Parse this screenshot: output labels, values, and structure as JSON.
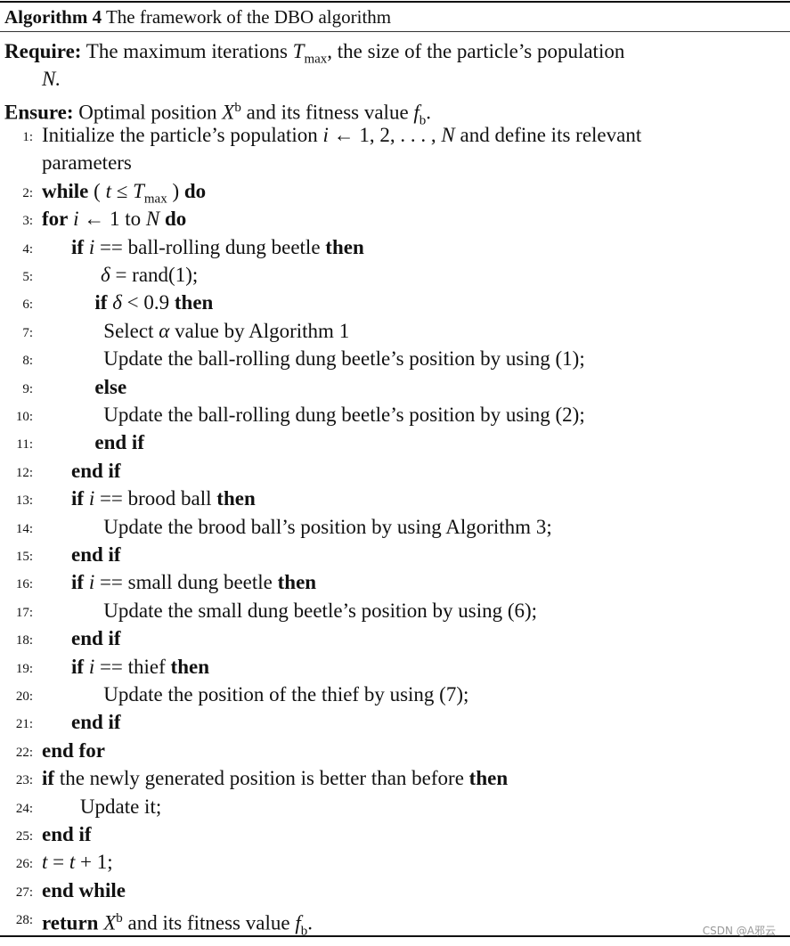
{
  "caption": {
    "label": "Algorithm 4",
    "title": "The framework of the DBO algorithm"
  },
  "require": {
    "label": "Require:",
    "text_a": "The maximum iterations ",
    "var": "T",
    "sub": "max",
    "text_b": ", the size of the particle’s population",
    "cont": "N."
  },
  "ensure": {
    "label": "Ensure:",
    "text_a": "Optimal position ",
    "var": "X",
    "sup": "b",
    "text_b": " and its fitness value ",
    "var2": "f",
    "sub2": "b",
    "end": "."
  },
  "lines": [
    {
      "n": "1:",
      "parts": [
        [
          "t",
          "Initialize the particle’s population "
        ],
        [
          "i",
          "i"
        ],
        [
          "t",
          " ← 1, 2, . . . , "
        ],
        [
          "i",
          "N"
        ],
        [
          "t",
          " and define its relevant"
        ]
      ],
      "indent": 0
    },
    {
      "n": "",
      "parts": [
        [
          "t",
          "parameters"
        ]
      ],
      "indent": 0
    },
    {
      "n": "2:",
      "parts": [
        [
          "k",
          "while"
        ],
        [
          "t",
          " ( "
        ],
        [
          "i",
          "t"
        ],
        [
          "t",
          " ≤ "
        ],
        [
          "i",
          "T"
        ],
        [
          "sub",
          "max"
        ],
        [
          "t",
          " ) "
        ],
        [
          "k",
          "do"
        ]
      ],
      "indent": 0
    },
    {
      "n": "3:",
      "parts": [
        [
          "k",
          "for"
        ],
        [
          "t",
          " "
        ],
        [
          "i",
          "i"
        ],
        [
          "t",
          " ← 1 to "
        ],
        [
          "i",
          "N"
        ],
        [
          "t",
          " "
        ],
        [
          "k",
          "do"
        ]
      ],
      "indent": 0
    },
    {
      "n": "4:",
      "parts": [
        [
          "k",
          "if"
        ],
        [
          "t",
          " "
        ],
        [
          "i",
          "i"
        ],
        [
          "t",
          " == ball-rolling dung beetle "
        ],
        [
          "k",
          "then"
        ]
      ],
      "indent": 1
    },
    {
      "n": "5:",
      "parts": [
        [
          "i",
          "δ"
        ],
        [
          "t",
          " = rand(1);"
        ]
      ],
      "indent": 2
    },
    {
      "n": "6:",
      "parts": [
        [
          "k",
          "if"
        ],
        [
          "t",
          " "
        ],
        [
          "i",
          "δ"
        ],
        [
          "t",
          " < 0.9 "
        ],
        [
          "k",
          "then"
        ]
      ],
      "indent": 1.8
    },
    {
      "n": "7:",
      "parts": [
        [
          "t",
          "Select "
        ],
        [
          "i",
          "α"
        ],
        [
          "t",
          " value by Algorithm 1"
        ]
      ],
      "indent": 2.1
    },
    {
      "n": "8:",
      "parts": [
        [
          "t",
          "Update the ball-rolling dung beetle’s position by using (1);"
        ]
      ],
      "indent": 2.1
    },
    {
      "n": "9:",
      "parts": [
        [
          "k",
          "else"
        ]
      ],
      "indent": 1.8
    },
    {
      "n": "10:",
      "parts": [
        [
          "t",
          "Update the ball-rolling dung beetle’s position by using (2);"
        ]
      ],
      "indent": 2.1
    },
    {
      "n": "11:",
      "parts": [
        [
          "k",
          "end if"
        ]
      ],
      "indent": 1.8
    },
    {
      "n": "12:",
      "parts": [
        [
          "k",
          "end if"
        ]
      ],
      "indent": 1
    },
    {
      "n": "13:",
      "parts": [
        [
          "k",
          "if"
        ],
        [
          "t",
          " "
        ],
        [
          "i",
          "i"
        ],
        [
          "t",
          " == brood ball "
        ],
        [
          "k",
          "then"
        ]
      ],
      "indent": 1
    },
    {
      "n": "14:",
      "parts": [
        [
          "t",
          "Update the brood ball’s position by using Algorithm 3;"
        ]
      ],
      "indent": 2.1
    },
    {
      "n": "15:",
      "parts": [
        [
          "k",
          "end if"
        ]
      ],
      "indent": 1
    },
    {
      "n": "16:",
      "parts": [
        [
          "k",
          "if"
        ],
        [
          "t",
          " "
        ],
        [
          "i",
          "i"
        ],
        [
          "t",
          " == small dung beetle "
        ],
        [
          "k",
          "then"
        ]
      ],
      "indent": 1
    },
    {
      "n": "17:",
      "parts": [
        [
          "t",
          "Update the small dung beetle’s position by using (6);"
        ]
      ],
      "indent": 2.1
    },
    {
      "n": "18:",
      "parts": [
        [
          "k",
          "end if"
        ]
      ],
      "indent": 1
    },
    {
      "n": "19:",
      "parts": [
        [
          "k",
          "if"
        ],
        [
          "t",
          " "
        ],
        [
          "i",
          "i"
        ],
        [
          "t",
          " == thief "
        ],
        [
          "k",
          "then"
        ]
      ],
      "indent": 1
    },
    {
      "n": "20:",
      "parts": [
        [
          "t",
          "Update the position of the thief by using (7);"
        ]
      ],
      "indent": 2.1
    },
    {
      "n": "21:",
      "parts": [
        [
          "k",
          "end if"
        ]
      ],
      "indent": 1
    },
    {
      "n": "22:",
      "parts": [
        [
          "k",
          "end for"
        ]
      ],
      "indent": 0
    },
    {
      "n": "23:",
      "parts": [
        [
          "k",
          "if"
        ],
        [
          "t",
          " the newly generated position is better than before "
        ],
        [
          "k",
          "then"
        ]
      ],
      "indent": 0
    },
    {
      "n": "24:",
      "parts": [
        [
          "t",
          "Update it;"
        ]
      ],
      "indent": 1.3
    },
    {
      "n": "25:",
      "parts": [
        [
          "k",
          "end if"
        ]
      ],
      "indent": 0
    },
    {
      "n": "26:",
      "parts": [
        [
          "i",
          "t"
        ],
        [
          "t",
          " = "
        ],
        [
          "i",
          "t"
        ],
        [
          "t",
          " + 1;"
        ]
      ],
      "indent": 0
    },
    {
      "n": "27:",
      "parts": [
        [
          "k",
          "end while"
        ]
      ],
      "indent": 0
    },
    {
      "n": "28:",
      "parts": [
        [
          "k",
          "return"
        ],
        [
          "t",
          " "
        ],
        [
          "i",
          "X"
        ],
        [
          "sup",
          "b"
        ],
        [
          "t",
          " and its fitness value "
        ],
        [
          "i",
          "f"
        ],
        [
          "sub",
          "b"
        ],
        [
          "t",
          "."
        ]
      ],
      "indent": 0
    }
  ],
  "watermark": "CSDN @A邪云"
}
